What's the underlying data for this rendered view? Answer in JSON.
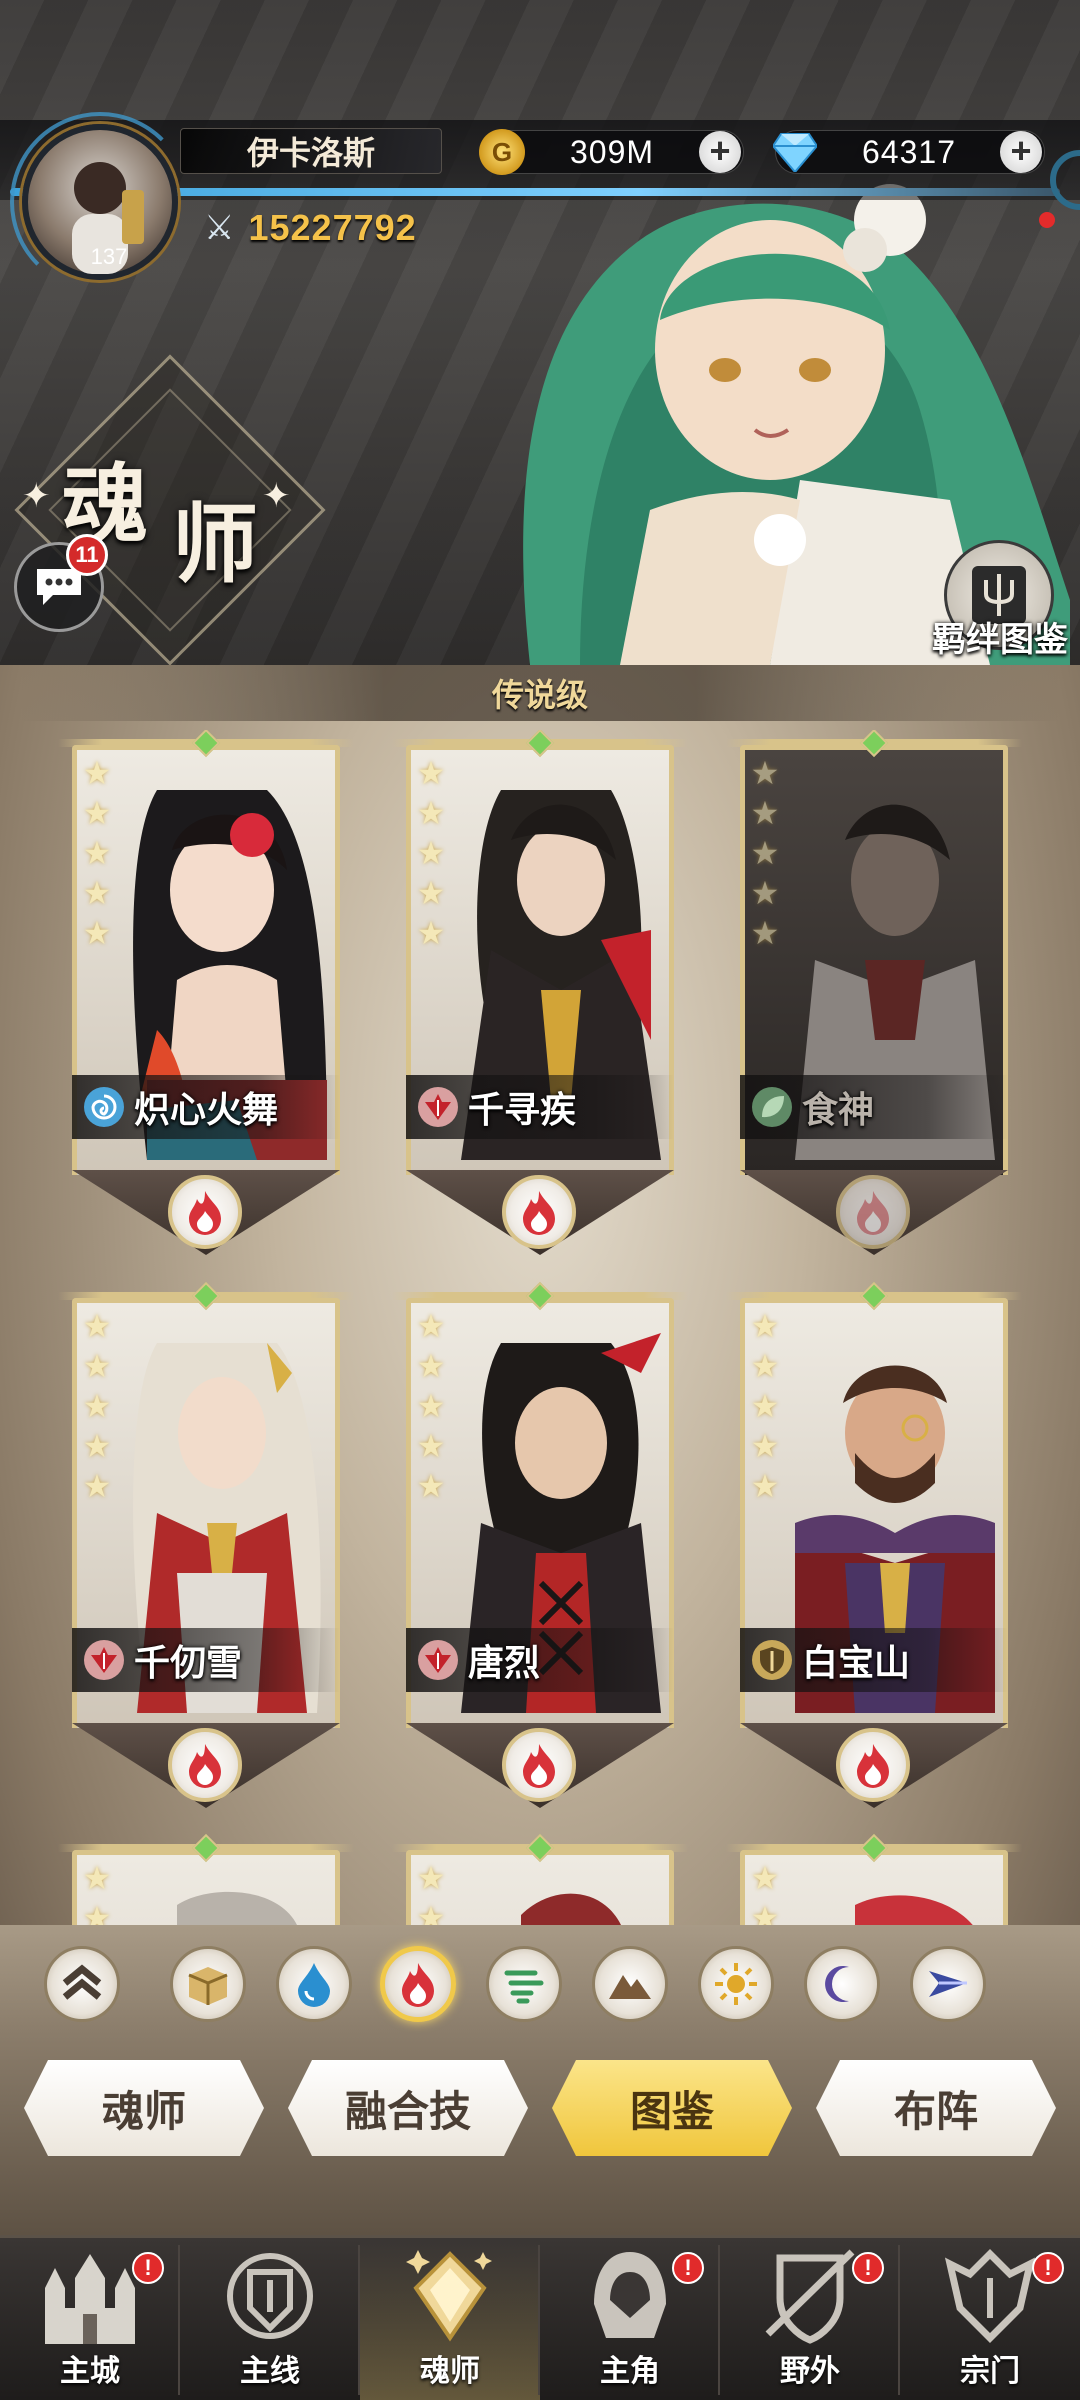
{
  "player": {
    "name": "伊卡洛斯",
    "level": "137",
    "power": "15227792"
  },
  "resources": {
    "gold": "309M",
    "gems": "64317"
  },
  "page": {
    "title_char_1": "魂",
    "title_char_2": "师",
    "chat_unread": "11",
    "atlas_label": "羁绊图鉴"
  },
  "tier": {
    "label": "传说级"
  },
  "heroes": [
    {
      "name": "炽心火舞",
      "class_icon": "swirl-icon",
      "element": "fire",
      "stars": 5,
      "owned": true
    },
    {
      "name": "千寻疾",
      "class_icon": "sword-icon",
      "element": "fire",
      "stars": 5,
      "owned": true
    },
    {
      "name": "食神",
      "class_icon": "leaf-icon",
      "element": "fire",
      "stars": 5,
      "owned": false
    },
    {
      "name": "千仞雪",
      "class_icon": "sword-icon",
      "element": "fire",
      "stars": 5,
      "owned": true
    },
    {
      "name": "唐烈",
      "class_icon": "sword-icon",
      "element": "fire",
      "stars": 5,
      "owned": true
    },
    {
      "name": "白宝山",
      "class_icon": "shield-icon",
      "element": "fire",
      "stars": 5,
      "owned": true
    }
  ],
  "element_filters": [
    "rank-up-icon",
    "box-icon",
    "water-icon",
    "fire-icon",
    "wind-icon",
    "earth-icon",
    "light-icon",
    "dark-icon",
    "arrow-icon"
  ],
  "active_filter": "fire-icon",
  "tabs": [
    {
      "label": "魂师",
      "active": false
    },
    {
      "label": "融合技",
      "active": false
    },
    {
      "label": "图鉴",
      "active": true
    },
    {
      "label": "布阵",
      "active": false
    }
  ],
  "nav": [
    {
      "label": "主城",
      "alert": true,
      "active": false
    },
    {
      "label": "主线",
      "alert": false,
      "active": false
    },
    {
      "label": "魂师",
      "alert": false,
      "active": true
    },
    {
      "label": "主角",
      "alert": true,
      "active": false
    },
    {
      "label": "野外",
      "alert": true,
      "active": false
    },
    {
      "label": "宗门",
      "alert": true,
      "active": false
    }
  ],
  "alert_glyph": "!",
  "colors": {
    "gold_text": "#f5c24a",
    "active_tab": "#f0c63c",
    "alert_red": "#e12b2b",
    "card_frame": "#d8c38a"
  }
}
